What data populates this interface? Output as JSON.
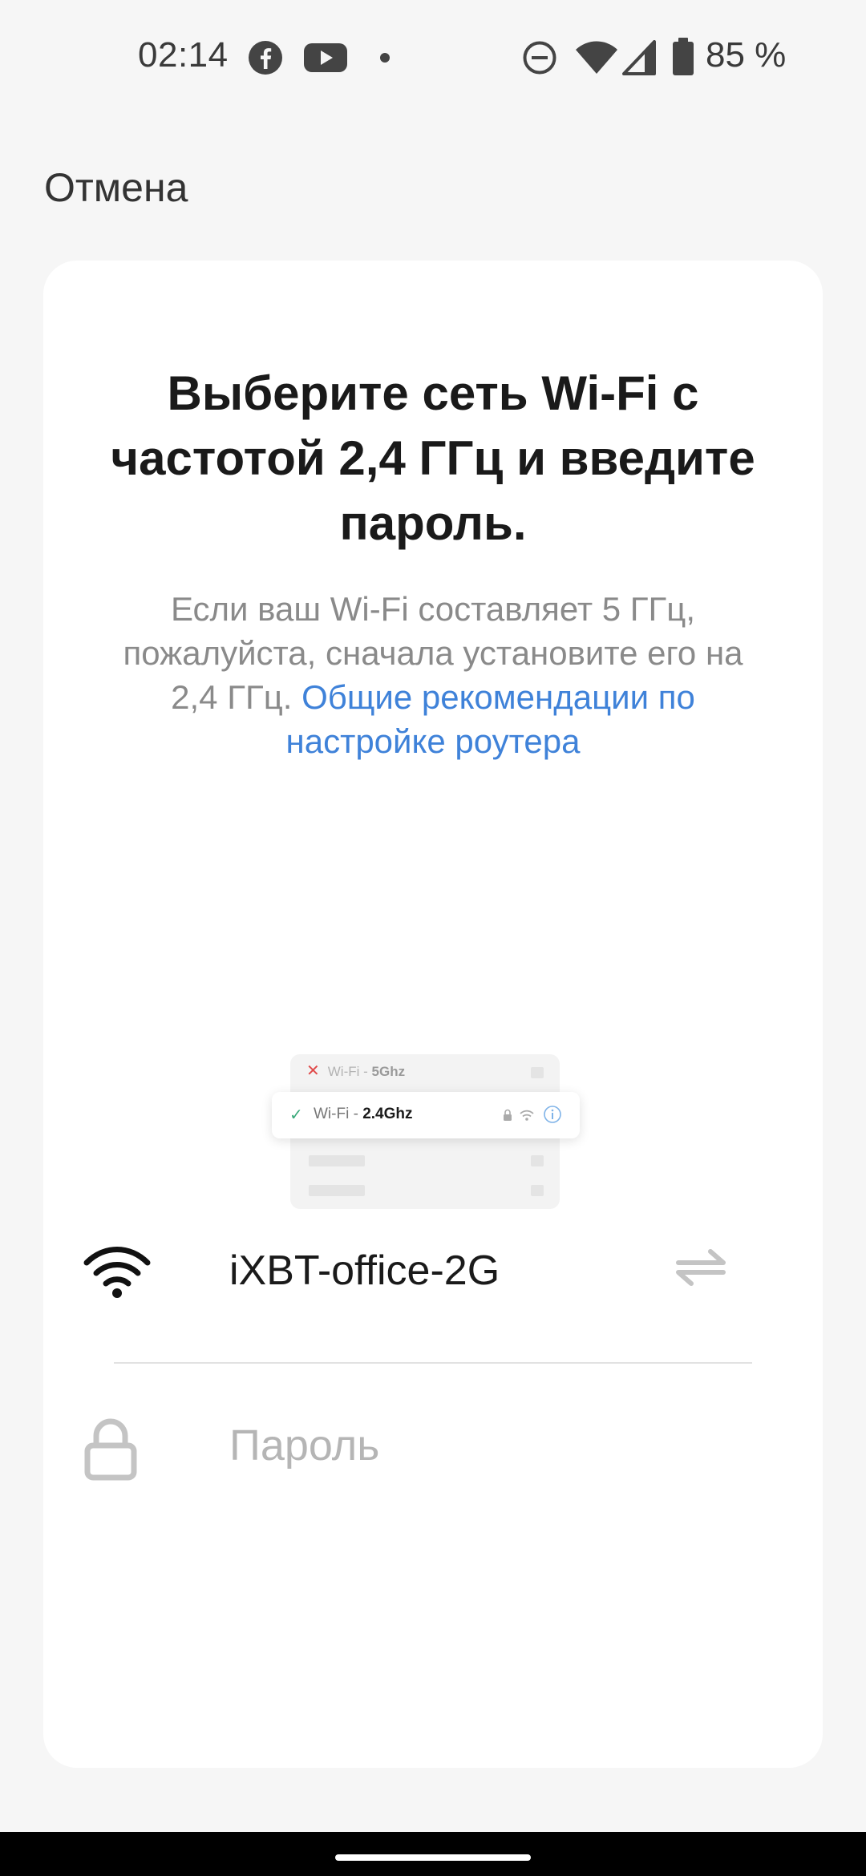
{
  "status_bar": {
    "time": "02:14",
    "battery_percent": "85 %",
    "icons": [
      "facebook-icon",
      "youtube-icon",
      "notification-dot-icon",
      "do-not-disturb-icon",
      "wifi-signal-icon",
      "cell-signal-icon",
      "battery-icon"
    ]
  },
  "header": {
    "cancel_label": "Отмена"
  },
  "card": {
    "title": "Выберите сеть Wi-Fi с частотой 2,4 ГГц и введите пароль.",
    "subtitle_text": "Если ваш Wi-Fi составляет 5 ГГц, пожалуйста, сначала установите его на 2,4 ГГц.",
    "subtitle_link": "Общие рекомендации по настройке роутера",
    "illustration": {
      "row_5g_prefix": "Wi-Fi - ",
      "row_5g_band": "5Ghz",
      "row_24g_prefix": "Wi-Fi - ",
      "row_24g_band": "2.4Ghz"
    },
    "wifi": {
      "network_name": "iXBT-office-2G",
      "icon": "wifi-icon",
      "switch_icon": "switch-network-icon"
    },
    "password": {
      "placeholder": "Пароль",
      "value": "",
      "icon": "lock-icon"
    }
  },
  "colors": {
    "background": "#f6f6f6",
    "card": "#ffffff",
    "link": "#3f82d9",
    "title": "#1a1a1a",
    "subtitle": "#8a8a8a"
  }
}
